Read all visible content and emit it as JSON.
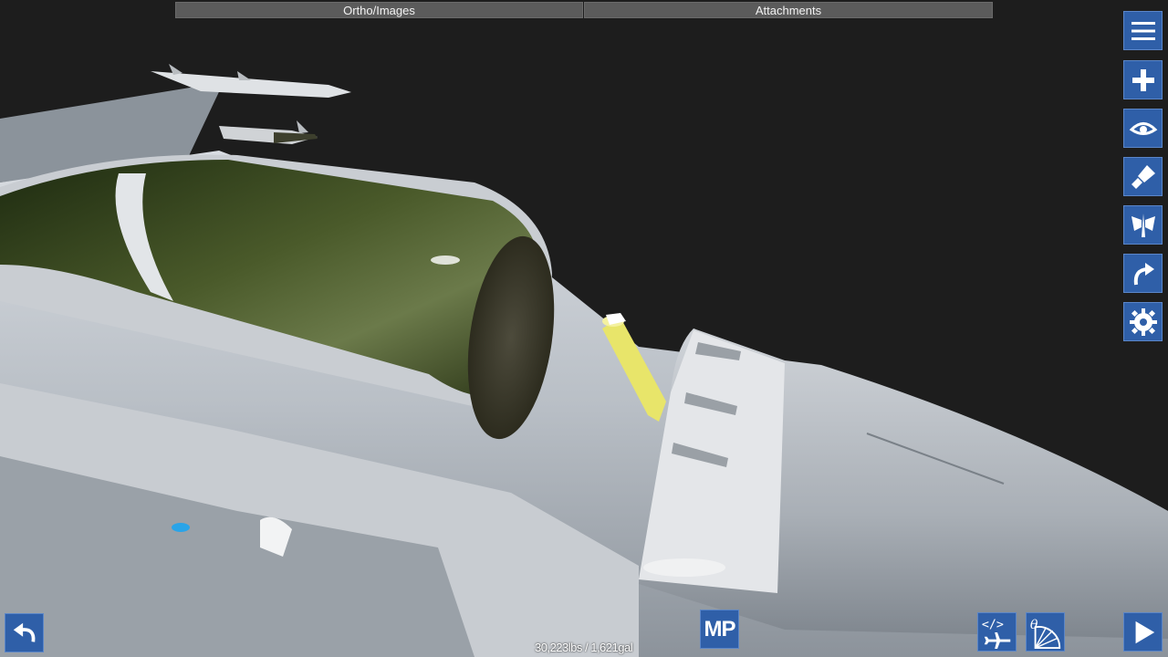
{
  "top_tabs": {
    "ortho_label": "Ortho/Images",
    "attachments_label": "Attachments"
  },
  "right_toolbar": [
    {
      "icon": "menu-icon"
    },
    {
      "icon": "plus-icon"
    },
    {
      "icon": "eye-icon"
    },
    {
      "icon": "paint-brush-icon"
    },
    {
      "icon": "symmetry-wings-icon"
    },
    {
      "icon": "redo-arrow-icon"
    },
    {
      "icon": "gear-icon"
    }
  ],
  "bottom": {
    "mp_label": "MP",
    "status_text": "30,223lbs / 1,621gal",
    "undo_icon": "undo-arrow-icon",
    "dev_icon": "code-airplane-icon",
    "theta_icon": "theta-angle-icon",
    "play_icon": "play-icon"
  },
  "colors": {
    "background": "#1d1d1d",
    "button_blue": "#2f5fa8",
    "tab_gray": "#5b5b5b",
    "selected_part": "#e8e56a"
  }
}
